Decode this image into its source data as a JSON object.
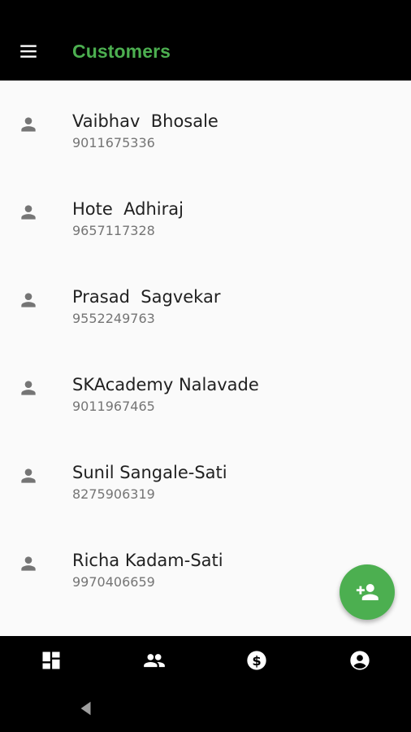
{
  "appbar": {
    "title": "Customers",
    "title_color": "#4caf50",
    "menu_icon": "menu-icon"
  },
  "customers": [
    {
      "name": "Vaibhav  Bhosale",
      "phone": "9011675336"
    },
    {
      "name": "Hote  Adhiraj",
      "phone": "9657117328"
    },
    {
      "name": "Prasad  Sagvekar",
      "phone": "9552249763"
    },
    {
      "name": "SKAcademy Nalavade",
      "phone": "9011967465"
    },
    {
      "name": "Sunil Sangale-Sati",
      "phone": "8275906319"
    },
    {
      "name": "Richa Kadam-Sati",
      "phone": "9970406659"
    }
  ],
  "fab": {
    "icon": "person-add-icon",
    "color": "#4caf50"
  },
  "bottom_nav": [
    {
      "id": "dashboard",
      "icon": "dashboard-icon"
    },
    {
      "id": "customers",
      "icon": "people-icon"
    },
    {
      "id": "payments",
      "icon": "dollar-icon"
    },
    {
      "id": "profile",
      "icon": "account-circle-icon"
    }
  ],
  "system_nav": {
    "back_icon": "back-triangle-icon"
  }
}
